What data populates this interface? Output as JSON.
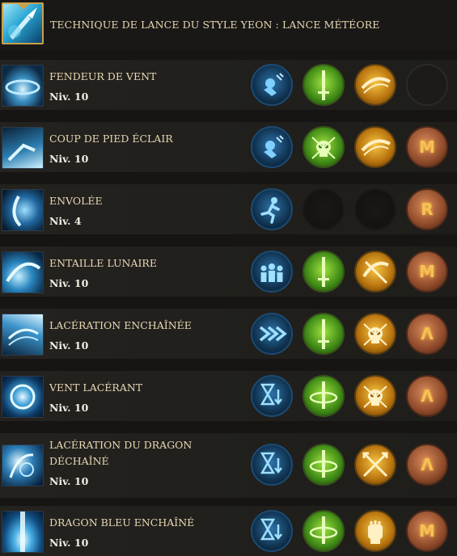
{
  "header": {
    "title": "TECHNIQUE DE LANCE DU STYLE YEON : LANCE MÉTÉORE",
    "icon": "lance-meteore-icon"
  },
  "colors": {
    "background": "#161513",
    "row_background": "#22201d",
    "title_text": "#e8d8b4",
    "level_text": "#f2ede2",
    "gold_frame": "#c9a14a"
  },
  "skills": [
    {
      "name": "FENDEUR DE VENT",
      "level": "Niv. 10",
      "tripods": [
        {
          "tier": 1,
          "color": "blue",
          "icon": "stagger-icon"
        },
        {
          "tier": 2,
          "color": "green",
          "icon": "sword-icon"
        },
        {
          "tier": 3,
          "color": "yellow",
          "icon": "slash-icon"
        },
        {
          "slot": "rune",
          "state": "empty"
        }
      ]
    },
    {
      "name": "COUP DE PIED ÉCLAIR",
      "level": "Niv. 10",
      "tripods": [
        {
          "tier": 1,
          "color": "blue",
          "icon": "stagger-icon"
        },
        {
          "tier": 2,
          "color": "green",
          "icon": "skull-icon"
        },
        {
          "tier": 3,
          "color": "yellow",
          "icon": "slash-icon"
        },
        {
          "slot": "rune",
          "glyph": "M",
          "icon": "rune-icon"
        }
      ]
    },
    {
      "name": "ENVOLÉE",
      "level": "Niv. 4",
      "tripods": [
        {
          "tier": 1,
          "color": "blue",
          "icon": "running-man-icon"
        },
        {
          "tier": 2,
          "state": "locked"
        },
        {
          "tier": 3,
          "state": "locked"
        },
        {
          "slot": "rune",
          "glyph": "R",
          "icon": "rune-icon"
        }
      ]
    },
    {
      "name": "ENTAILLE LUNAIRE",
      "level": "Niv. 10",
      "tripods": [
        {
          "tier": 1,
          "color": "blue",
          "icon": "party-icon"
        },
        {
          "tier": 2,
          "color": "green",
          "icon": "sword-icon"
        },
        {
          "tier": 3,
          "color": "yellow",
          "icon": "cross-slash-icon"
        },
        {
          "slot": "rune",
          "glyph": "M",
          "icon": "rune-icon"
        }
      ]
    },
    {
      "name": "LACÉRATION ENCHAÎNÉE",
      "level": "Niv. 10",
      "tripods": [
        {
          "tier": 1,
          "color": "blue",
          "icon": "double-chevron-icon"
        },
        {
          "tier": 2,
          "color": "green",
          "icon": "sword-icon"
        },
        {
          "tier": 3,
          "color": "yellow",
          "icon": "skull-icon"
        },
        {
          "slot": "rune",
          "glyph": "Λ",
          "icon": "rune-icon"
        }
      ]
    },
    {
      "name": "VENT LACÉRANT",
      "level": "Niv. 10",
      "tripods": [
        {
          "tier": 1,
          "color": "blue",
          "icon": "hourglass-icon"
        },
        {
          "tier": 2,
          "color": "green",
          "icon": "sword-swirl-icon"
        },
        {
          "tier": 3,
          "color": "yellow",
          "icon": "skull-icon"
        },
        {
          "slot": "rune",
          "glyph": "Λ",
          "icon": "rune-icon"
        }
      ]
    },
    {
      "name": "LACÉRATION DU DRAGON DÉCHAÎNÉ",
      "level": "Niv. 10",
      "tripods": [
        {
          "tier": 1,
          "color": "blue",
          "icon": "hourglass-icon"
        },
        {
          "tier": 2,
          "color": "green",
          "icon": "sword-swirl-icon"
        },
        {
          "tier": 3,
          "color": "yellow",
          "icon": "crossed-arrows-icon"
        },
        {
          "slot": "rune",
          "glyph": "Λ",
          "icon": "rune-icon"
        }
      ]
    },
    {
      "name": "DRAGON BLEU ENCHAÎNÉ",
      "level": "Niv. 10",
      "tripods": [
        {
          "tier": 1,
          "color": "blue",
          "icon": "hourglass-icon"
        },
        {
          "tier": 2,
          "color": "green",
          "icon": "sword-swirl-icon"
        },
        {
          "tier": 3,
          "color": "yellow",
          "icon": "fist-icon"
        },
        {
          "slot": "rune",
          "glyph": "M",
          "icon": "rune-icon"
        }
      ]
    }
  ]
}
